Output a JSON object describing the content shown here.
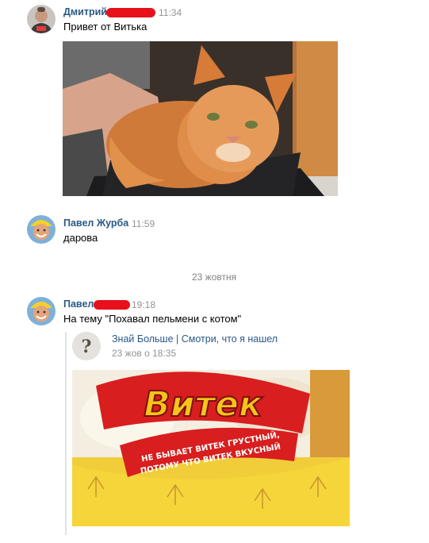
{
  "messages": [
    {
      "author": "Дмитрий",
      "time": "11:34",
      "text": "Привет от Витька",
      "author_redacted": true
    },
    {
      "author": "Павел Журба",
      "time": "11:59",
      "text": "дарова"
    },
    {
      "author": "Павел",
      "time": "19:18",
      "text": "На тему \"Похавал пельмени с котом\"",
      "author_redacted": true
    }
  ],
  "date_separator": "23 жовтня",
  "repost": {
    "group_name": "Знай Больше | Смотри, что я нашел",
    "date": "23 жов о 18:35",
    "group_icon": "question-mark-icon",
    "group_icon_glyph": "?",
    "package_brand": "Витек",
    "package_slogan_line1": "НЕ БЫВАЕТ ВИТЕК ГРУСТНЫЙ,",
    "package_slogan_line2": "ПОТОМУ ЧТО ВИТЕК ВКУСНЫЙ"
  },
  "colors": {
    "author_link": "#2a5885",
    "time_gray": "#939393",
    "redaction_red": "#e8101a"
  }
}
